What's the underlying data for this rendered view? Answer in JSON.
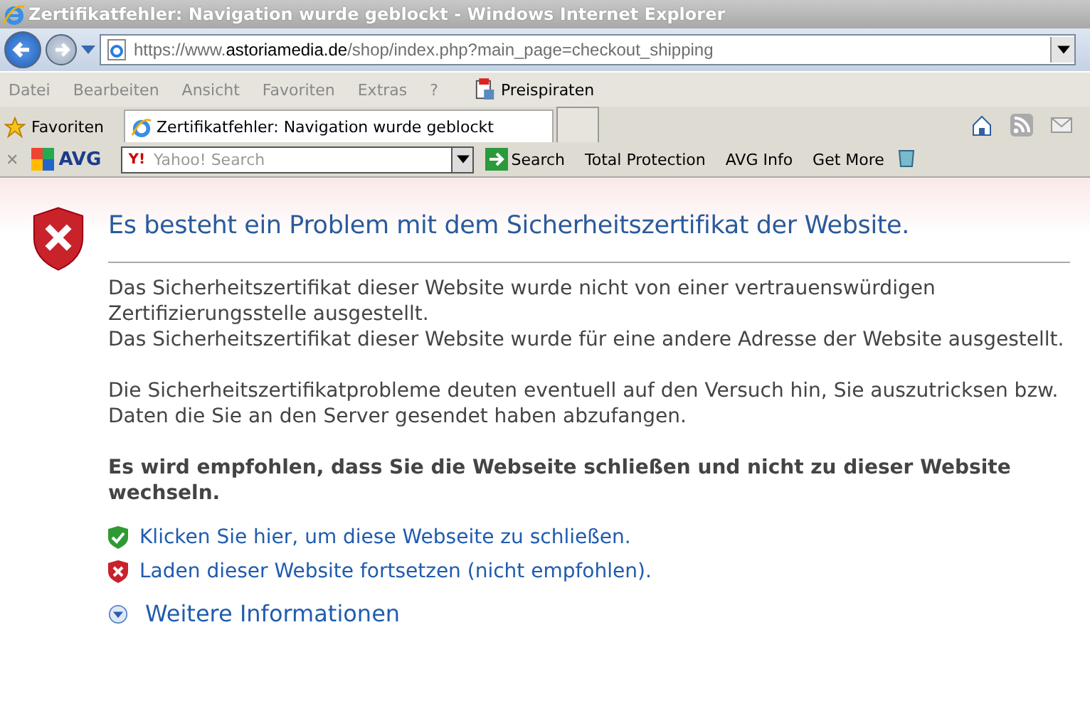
{
  "window": {
    "title": "Zertifikatfehler: Navigation wurde geblockt - Windows Internet Explorer"
  },
  "address": {
    "prefix": "https://www.",
    "domain": "astoriamedia.de",
    "path": "/shop/index.php?main_page=checkout_shipping"
  },
  "menu": [
    "Datei",
    "Bearbeiten",
    "Ansicht",
    "Favoriten",
    "Extras",
    "?"
  ],
  "menu_addon": "Preispiraten",
  "favorites": "Favoriten",
  "tabs": [
    {
      "label": "Zertifikatfehler: Navigation wurde geblockt",
      "selected": true
    }
  ],
  "avg_toolbar": {
    "close": "✕",
    "logo": "AVG",
    "search_engine_mark": "Y!",
    "search_placeholder": "Yahoo! Search",
    "search_button": "Search",
    "items": [
      "Total Protection",
      "AVG Info",
      "Get More"
    ]
  },
  "page": {
    "heading": "Es besteht ein Problem mit dem Sicherheitszertifikat der Website.",
    "paragraphs": [
      [
        "Das Sicherheitszertifikat dieser Website wurde nicht von einer vertrauenswürdigen Zertifizierungsstelle ausgestellt.",
        "Das Sicherheitszertifikat dieser Website wurde für eine andere Adresse der Website ausgestellt."
      ],
      [
        "Die Sicherheitszertifikatprobleme deuten eventuell auf den Versuch hin, Sie auszutricksen bzw. Daten die Sie an den Server gesendet haben abzufangen."
      ]
    ],
    "recommendation": "Es wird empfohlen, dass Sie die Webseite schließen und nicht zu dieser Website wechseln.",
    "links": [
      {
        "kind": "safe",
        "label": "Klicken Sie hier, um diese Webseite zu schließen."
      },
      {
        "kind": "unsafe",
        "label": "Laden dieser Website fortsetzen (nicht empfohlen)."
      }
    ],
    "more_info": "Weitere Informationen"
  }
}
